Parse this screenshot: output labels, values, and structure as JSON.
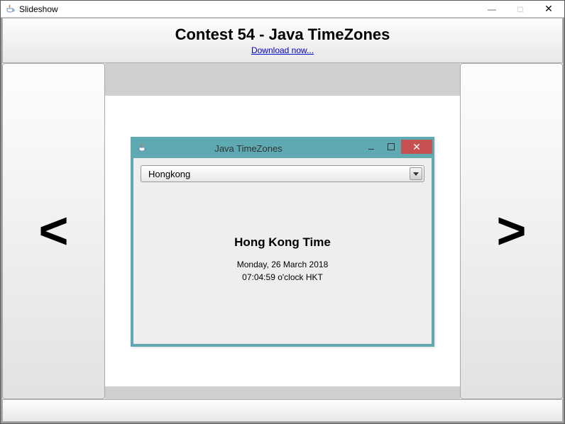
{
  "window": {
    "title": "Slideshow",
    "minimize_glyph": "—",
    "maximize_glyph": "□",
    "close_glyph": "✕"
  },
  "header": {
    "title": "Contest 54 - Java TimeZones",
    "download_link": "Download now..."
  },
  "nav": {
    "prev_glyph": "<",
    "next_glyph": ">"
  },
  "inner_window": {
    "title": "Java TimeZones",
    "close_glyph": "✕",
    "combo_selected": "Hongkong",
    "zone_heading": "Hong Kong Time",
    "date_line": "Monday, 26 March 2018",
    "time_line": "07:04:59 o'clock HKT"
  }
}
